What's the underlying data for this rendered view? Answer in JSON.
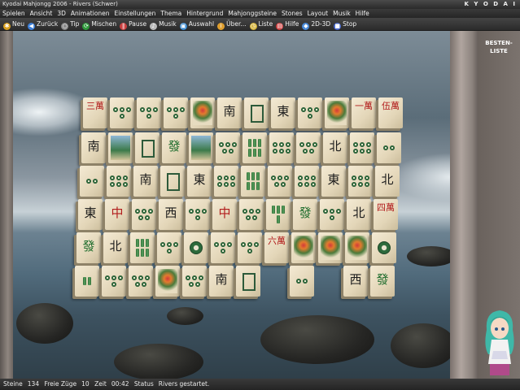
{
  "window": {
    "title": "Kyodai Mahjongg 2006 - Rivers (Schwer)",
    "brand": "K Y O D A I"
  },
  "menu": [
    "Spielen",
    "Ansicht",
    "3D",
    "Animationen",
    "Einstellungen",
    "Thema",
    "Hintergrund",
    "Mahjonggsteine",
    "Stones",
    "Layout",
    "Musik",
    "Hilfe"
  ],
  "toolbar": [
    {
      "label": "Neu",
      "icon": "new-icon",
      "color": "#d9a020"
    },
    {
      "label": "Zurück",
      "icon": "back-icon",
      "color": "#3d7fd8"
    },
    {
      "label": "Tip",
      "icon": "magnifier-icon",
      "color": "#8a8a8a"
    },
    {
      "label": "Mischen",
      "icon": "shuffle-icon",
      "color": "#2f9a3c"
    },
    {
      "label": "Pause",
      "icon": "pause-icon",
      "color": "#c94040"
    },
    {
      "label": "Musik",
      "icon": "note-icon",
      "color": "#bbbbbb"
    },
    {
      "label": "Auswahl",
      "icon": "select-icon",
      "color": "#3a8ad0"
    },
    {
      "label": "Über...",
      "icon": "info-icon",
      "color": "#e0a030"
    },
    {
      "label": "Liste",
      "icon": "clock-icon",
      "color": "#d6b640"
    },
    {
      "label": "Hilfe",
      "icon": "book-icon",
      "color": "#d04040"
    },
    {
      "label": "2D-3D",
      "icon": "cube-icon",
      "color": "#4a8ad8"
    },
    {
      "label": "Stop",
      "icon": "stop-icon",
      "color": "#4a6ad0"
    }
  ],
  "side_panel": {
    "best_label_line1": "BESTEN-",
    "best_label_line2": "LISTE"
  },
  "status": {
    "stones_label": "Steine",
    "stones_value": "134",
    "moves_label": "Freie Züge",
    "moves_value": "10",
    "time_label": "Zeit",
    "time_value": "00:42",
    "status_label": "Status",
    "status_value": "Rivers gestartet."
  },
  "tiles": [
    {
      "row": 0,
      "col": 0,
      "kind": "char",
      "glyph": "三萬",
      "tone": "red"
    },
    {
      "row": 0,
      "col": 1,
      "kind": "dots",
      "n": 4
    },
    {
      "row": 0,
      "col": 2,
      "kind": "dots",
      "n": 4
    },
    {
      "row": 0,
      "col": 3,
      "kind": "dots",
      "n": 4
    },
    {
      "row": 0,
      "col": 4,
      "kind": "flower"
    },
    {
      "row": 0,
      "col": 5,
      "kind": "char",
      "glyph": "南"
    },
    {
      "row": 0,
      "col": 6,
      "kind": "square"
    },
    {
      "row": 0,
      "col": 7,
      "kind": "char",
      "glyph": "東"
    },
    {
      "row": 0,
      "col": 8,
      "kind": "dots",
      "n": 4
    },
    {
      "row": 0,
      "col": 9,
      "kind": "flower"
    },
    {
      "row": 0,
      "col": 10,
      "kind": "char",
      "glyph": "一萬",
      "tone": "red"
    },
    {
      "row": 0,
      "col": 11,
      "kind": "char",
      "glyph": "伍萬",
      "tone": "red"
    },
    {
      "row": 1,
      "col": 0,
      "kind": "char",
      "glyph": "南"
    },
    {
      "row": 1,
      "col": 1,
      "kind": "scenery"
    },
    {
      "row": 1,
      "col": 2,
      "kind": "square"
    },
    {
      "row": 1,
      "col": 3,
      "kind": "char",
      "glyph": "發",
      "tone": "green"
    },
    {
      "row": 1,
      "col": 4,
      "kind": "scenery"
    },
    {
      "row": 1,
      "col": 5,
      "kind": "dots",
      "n": 5
    },
    {
      "row": 1,
      "col": 6,
      "kind": "bamboo",
      "n": 6
    },
    {
      "row": 1,
      "col": 7,
      "kind": "dots",
      "n": 6
    },
    {
      "row": 1,
      "col": 8,
      "kind": "dots",
      "n": 5
    },
    {
      "row": 1,
      "col": 9,
      "kind": "char",
      "glyph": "北"
    },
    {
      "row": 1,
      "col": 10,
      "kind": "dots",
      "n": 6
    },
    {
      "row": 1,
      "col": 11,
      "kind": "dots",
      "n": 2
    },
    {
      "row": 2,
      "col": 0,
      "kind": "dots",
      "n": 2
    },
    {
      "row": 2,
      "col": 1,
      "kind": "dots",
      "n": 6
    },
    {
      "row": 2,
      "col": 2,
      "kind": "char",
      "glyph": "南"
    },
    {
      "row": 2,
      "col": 3,
      "kind": "square"
    },
    {
      "row": 2,
      "col": 4,
      "kind": "char",
      "glyph": "東"
    },
    {
      "row": 2,
      "col": 5,
      "kind": "dots",
      "n": 6
    },
    {
      "row": 2,
      "col": 6,
      "kind": "bamboo",
      "n": 6
    },
    {
      "row": 2,
      "col": 7,
      "kind": "dots",
      "n": 5
    },
    {
      "row": 2,
      "col": 8,
      "kind": "dots",
      "n": 6
    },
    {
      "row": 2,
      "col": 9,
      "kind": "char",
      "glyph": "東"
    },
    {
      "row": 2,
      "col": 10,
      "kind": "dots",
      "n": 6
    },
    {
      "row": 2,
      "col": 11,
      "kind": "char",
      "glyph": "北"
    },
    {
      "row": 3,
      "col": 0,
      "kind": "char",
      "glyph": "東"
    },
    {
      "row": 3,
      "col": 1,
      "kind": "char",
      "glyph": "中",
      "tone": "red"
    },
    {
      "row": 3,
      "col": 2,
      "kind": "dots",
      "n": 5
    },
    {
      "row": 3,
      "col": 3,
      "kind": "char",
      "glyph": "西"
    },
    {
      "row": 3,
      "col": 4,
      "kind": "dots",
      "n": 4
    },
    {
      "row": 3,
      "col": 5,
      "kind": "char",
      "glyph": "中",
      "tone": "red"
    },
    {
      "row": 3,
      "col": 6,
      "kind": "dots",
      "n": 5
    },
    {
      "row": 3,
      "col": 7,
      "kind": "bamboo",
      "n": 4
    },
    {
      "row": 3,
      "col": 8,
      "kind": "char",
      "glyph": "發",
      "tone": "green"
    },
    {
      "row": 3,
      "col": 9,
      "kind": "dots",
      "n": 4
    },
    {
      "row": 3,
      "col": 10,
      "kind": "char",
      "glyph": "北"
    },
    {
      "row": 3,
      "col": 11,
      "kind": "char",
      "glyph": "四萬",
      "tone": "red"
    },
    {
      "row": 4,
      "col": 0,
      "kind": "char",
      "glyph": "發",
      "tone": "green"
    },
    {
      "row": 4,
      "col": 1,
      "kind": "char",
      "glyph": "北"
    },
    {
      "row": 4,
      "col": 2,
      "kind": "bamboo",
      "n": 6
    },
    {
      "row": 4,
      "col": 3,
      "kind": "dots",
      "n": 4
    },
    {
      "row": 4,
      "col": 4,
      "kind": "dots",
      "n": 1
    },
    {
      "row": 4,
      "col": 5,
      "kind": "dots",
      "n": 4
    },
    {
      "row": 4,
      "col": 6,
      "kind": "dots",
      "n": 4
    },
    {
      "row": 4,
      "col": 7,
      "kind": "char",
      "glyph": "六萬",
      "tone": "red"
    },
    {
      "row": 4,
      "col": 8,
      "kind": "flower"
    },
    {
      "row": 4,
      "col": 9,
      "kind": "flower"
    },
    {
      "row": 4,
      "col": 10,
      "kind": "flower"
    },
    {
      "row": 4,
      "col": 11,
      "kind": "dots",
      "n": 1
    },
    {
      "row": 5,
      "col": 0,
      "kind": "bamboo",
      "n": 2
    },
    {
      "row": 5,
      "col": 1,
      "kind": "dots",
      "n": 4
    },
    {
      "row": 5,
      "col": 2,
      "kind": "dots",
      "n": 5
    },
    {
      "row": 5,
      "col": 3,
      "kind": "flower"
    },
    {
      "row": 5,
      "col": 4,
      "kind": "dots",
      "n": 5
    },
    {
      "row": 5,
      "col": 5,
      "kind": "char",
      "glyph": "南"
    },
    {
      "row": 5,
      "col": 6,
      "kind": "square"
    },
    {
      "row": 5,
      "col": 8,
      "kind": "dots",
      "n": 2
    },
    {
      "row": 5,
      "col": 10,
      "kind": "char",
      "glyph": "西"
    },
    {
      "row": 5,
      "col": 11,
      "kind": "char",
      "glyph": "發",
      "tone": "green"
    }
  ]
}
